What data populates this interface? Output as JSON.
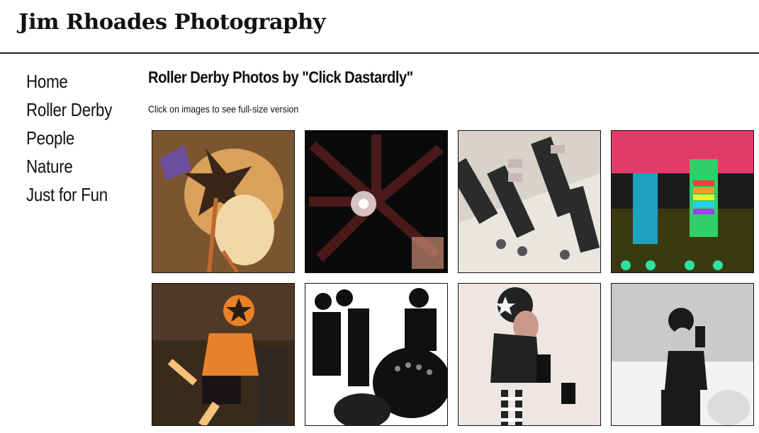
{
  "site": {
    "title": "Jim Rhoades Photography"
  },
  "nav": {
    "items": [
      {
        "label": "Home"
      },
      {
        "label": "Roller Derby"
      },
      {
        "label": "People"
      },
      {
        "label": "Nature"
      },
      {
        "label": "Just for Fun"
      }
    ]
  },
  "main": {
    "heading": "Roller Derby Photos by \"Click Dastardly\"",
    "instruction": "Click on images to see full-size version"
  },
  "gallery": {
    "images": [
      {
        "subject": "mosaic portrait of skater in star helmet",
        "palette": [
          "#6b4a2a",
          "#d9a15a",
          "#f1d7a8"
        ]
      },
      {
        "subject": "skaters' hands meeting in a circle, low-light burst",
        "palette": [
          "#0a0a0a",
          "#7a2a2a",
          "#f0e0e0"
        ]
      },
      {
        "subject": "legs in striped socks with quad skates on track",
        "palette": [
          "#d8d2c8",
          "#2b2b2b",
          "#c9b8b8"
        ]
      },
      {
        "subject": "neon-colored legs and skates, saturated",
        "palette": [
          "#1a1a1a",
          "#e23a6b",
          "#2fd06a"
        ]
      },
      {
        "subject": "skater in orange jersey and star helmet",
        "palette": [
          "#3a2a1a",
          "#e8822a",
          "#f5c07a"
        ]
      },
      {
        "subject": "high-contrast black and white crowd of skaters",
        "palette": [
          "#ffffff",
          "#101010",
          "#888888"
        ]
      },
      {
        "subject": "jammer in star helmet crouching, striped socks",
        "palette": [
          "#eee6e2",
          "#222222",
          "#c99a8a"
        ]
      },
      {
        "subject": "black and white skater in gym",
        "palette": [
          "#f2f2f2",
          "#1a1a1a",
          "#9a9a9a"
        ]
      }
    ]
  }
}
